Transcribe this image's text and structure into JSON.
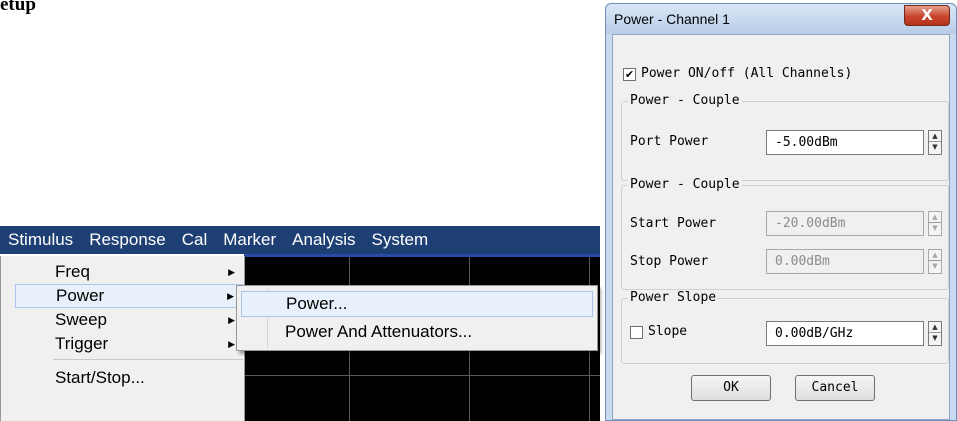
{
  "doc_heading": "etup",
  "menubar": {
    "items": [
      "Stimulus",
      "Response",
      "Cal",
      "Marker",
      "Analysis",
      "System"
    ]
  },
  "dropdown": {
    "items": [
      {
        "label": "Freq",
        "has_submenu": true
      },
      {
        "label": "Power",
        "has_submenu": true
      },
      {
        "label": "Sweep",
        "has_submenu": true
      },
      {
        "label": "Trigger",
        "has_submenu": true
      },
      {
        "label": "Start/Stop...",
        "has_submenu": false
      }
    ],
    "highlighted": "Power"
  },
  "submenu": {
    "items": [
      "Power...",
      "Power And Attenuators..."
    ],
    "highlighted": "Power..."
  },
  "dialog": {
    "title": "Power - Channel 1",
    "close_icon": "X",
    "power_onoff": {
      "label": "Power ON/off (All Channels)",
      "checked": true
    },
    "group1": {
      "legend": "Power - Couple",
      "port_power_label": "Port Power",
      "port_power_value": "-5.00dBm"
    },
    "group2": {
      "legend": "Power - Couple",
      "start_power_label": "Start Power",
      "start_power_value": "-20.00dBm",
      "stop_power_label": "Stop Power",
      "stop_power_value": "0.00dBm"
    },
    "group3": {
      "legend": "Power Slope",
      "slope_label": "Slope",
      "slope_checked": false,
      "slope_value": "0.00dB/GHz"
    },
    "ok_label": "OK",
    "cancel_label": "Cancel"
  },
  "colors": {
    "menubar_bg": "#1e3f73",
    "highlight_bg": "#e8f0fb",
    "close_red": "#c7452b",
    "dialog_frame": "#c9daef"
  }
}
